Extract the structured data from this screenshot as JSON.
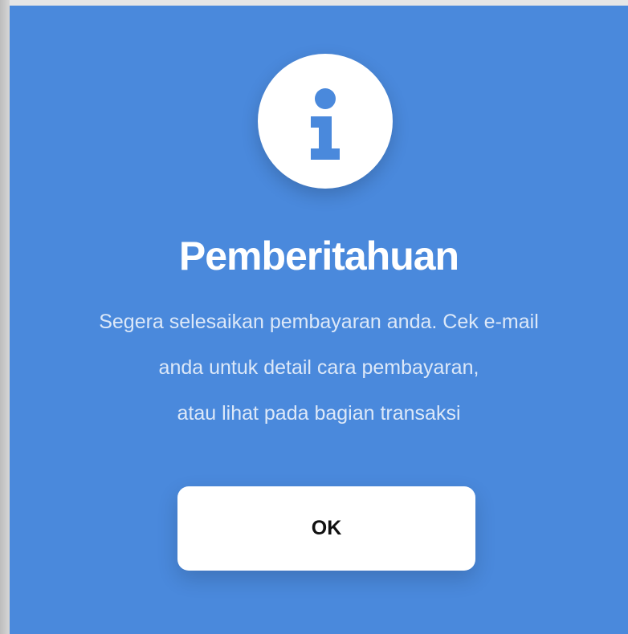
{
  "dialog": {
    "icon": "info-icon",
    "title": "Pemberitahuan",
    "message_lines": [
      "Segera selesaikan pembayaran anda. Cek e-mail",
      "anda untuk detail cara pembayaran,",
      "atau lihat pada bagian transaksi"
    ],
    "ok_label": "OK"
  },
  "colors": {
    "dialog_background": "#4a89dc",
    "icon_circle": "#ffffff",
    "icon_glyph": "#4a89dc",
    "title_text": "#ffffff",
    "message_text": "#dce8f8",
    "button_background": "#ffffff",
    "button_text": "#111111"
  }
}
